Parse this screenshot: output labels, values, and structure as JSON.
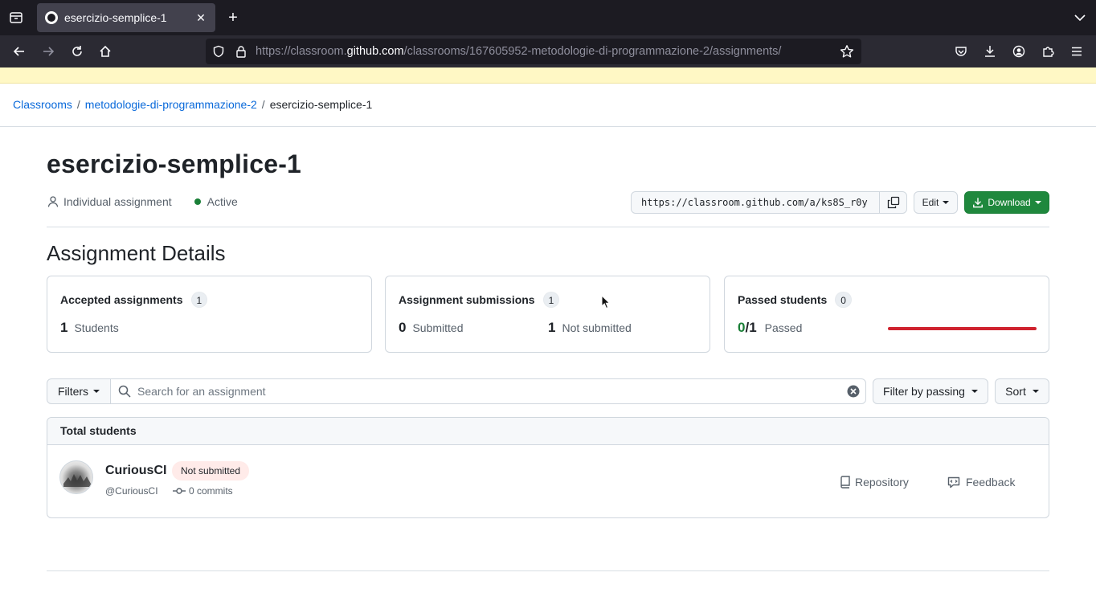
{
  "browser": {
    "tab_title": "esercizio-semplice-1",
    "new_tab_label": "+",
    "url_prefix": "https://classroom.",
    "url_host": "github.com",
    "url_path": "/classrooms/167605952-metodologie-di-programmazione-2/assignments/"
  },
  "breadcrumb": {
    "items": [
      "Classrooms",
      "metodologie-di-programmazione-2"
    ],
    "separator": "/",
    "current": "esercizio-semplice-1"
  },
  "assignment": {
    "title": "esercizio-semplice-1",
    "type_label": "Individual assignment",
    "status_label": "Active",
    "invite_url": "https://classroom.github.com/a/ks8S_r0y",
    "edit_label": "Edit",
    "download_label": "Download"
  },
  "details": {
    "heading": "Assignment Details",
    "accepted": {
      "title": "Accepted assignments",
      "count": "1",
      "num": "1",
      "label": "Students"
    },
    "submissions": {
      "title": "Assignment submissions",
      "count": "1",
      "submitted_num": "0",
      "submitted_label": "Submitted",
      "not_submitted_num": "1",
      "not_submitted_label": "Not submitted"
    },
    "passed": {
      "title": "Passed students",
      "count": "0",
      "passed_num": "0",
      "total": "/1",
      "label": "Passed",
      "passed_fraction": 0.0
    }
  },
  "toolbar": {
    "filters_label": "Filters",
    "search_placeholder": "Search for an assignment",
    "filter_passing_label": "Filter by passing",
    "sort_label": "Sort"
  },
  "students": {
    "header": "Total students",
    "rows": [
      {
        "name": "CuriousCI",
        "status": "Not submitted",
        "handle": "@CuriousCI",
        "commits": "0 commits",
        "repository_label": "Repository",
        "feedback_label": "Feedback"
      }
    ]
  },
  "colors": {
    "link": "#0969da",
    "success": "#1f883d",
    "danger": "#cf222e",
    "status_bg": "#ffebe9",
    "banner": "#fff8c5"
  },
  "icons": [
    "tab-list-icon",
    "github-favicon-icon",
    "close-icon",
    "back-icon",
    "forward-icon",
    "reload-icon",
    "home-icon",
    "shield-icon",
    "lock-icon",
    "star-icon",
    "pocket-icon",
    "download-icon",
    "account-icon",
    "extensions-icon",
    "menu-icon",
    "person-icon",
    "copy-icon",
    "search-icon",
    "clear-icon",
    "commit-icon",
    "repo-icon",
    "feedback-icon"
  ]
}
